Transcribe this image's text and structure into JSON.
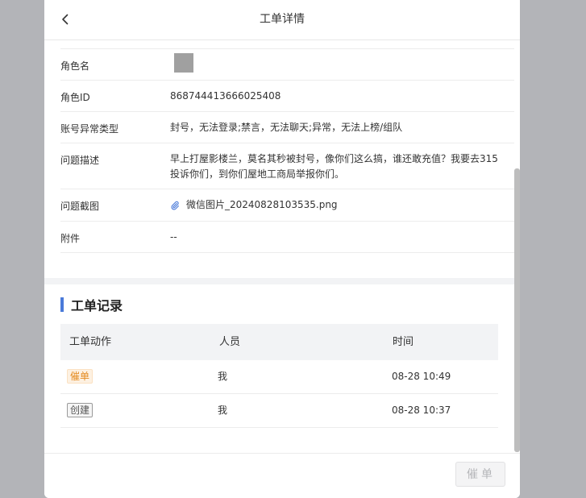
{
  "header": {
    "title": "工单详情",
    "back_icon": "chevron-left-icon"
  },
  "details": {
    "role_name": {
      "label": "角色名",
      "value": ""
    },
    "role_id": {
      "label": "角色ID",
      "value": "868744413666025408"
    },
    "account_issue_type": {
      "label": "账号异常类型",
      "value": "封号，无法登录;禁言，无法聊天;异常，无法上榜/组队"
    },
    "problem_description": {
      "label": "问题描述",
      "value": "早上打屋影楼兰，莫名其秒被封号，像你们这么搞，谁还敢充值？我要去315投诉你们，到你们屋地工商局举报你们。"
    },
    "problem_screenshot": {
      "label": "问题截图",
      "file_name": "微信图片_20240828103535.png",
      "icon": "paperclip-icon"
    },
    "attachment": {
      "label": "附件",
      "value": "--"
    }
  },
  "records": {
    "title": "工单记录",
    "columns": [
      "工单动作",
      "人员",
      "时间"
    ],
    "rows": [
      {
        "action": "催单",
        "person": "我",
        "time": "08-28 10:49"
      },
      {
        "action": "创建",
        "person": "我",
        "time": "08-28 10:37"
      }
    ]
  },
  "footer": {
    "urge_label": "催单"
  },
  "colors": {
    "accent": "#4a7ad9",
    "urge_tag": "#e48a1f",
    "overlay": "#b3b4b8"
  }
}
